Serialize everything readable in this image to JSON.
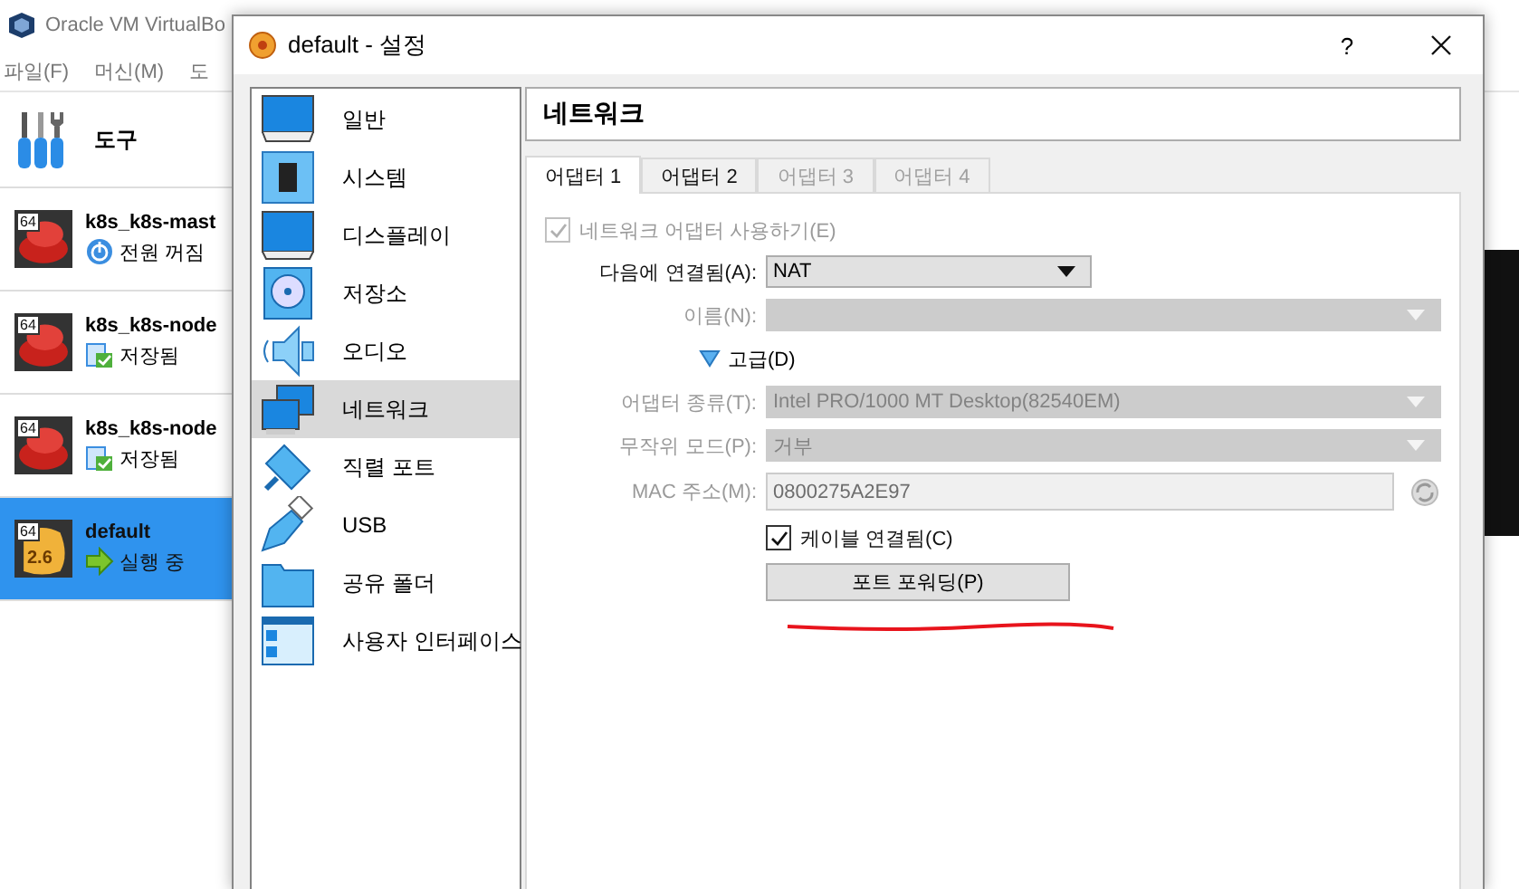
{
  "manager": {
    "title": "Oracle VM VirtualBo",
    "menu": [
      "파일(F)",
      "머신(M)",
      "도"
    ],
    "tools_label": "도구",
    "vms": [
      {
        "name": "k8s_k8s-mast",
        "state": "전원 꺼짐",
        "kind": "off",
        "version": "64",
        "selected": false
      },
      {
        "name": "k8s_k8s-node",
        "state": "저장됨",
        "kind": "saved",
        "version": "64",
        "selected": false
      },
      {
        "name": "k8s_k8s-node",
        "state": "저장됨",
        "kind": "saved",
        "version": "64",
        "selected": false
      },
      {
        "name": "default",
        "state": "실행 중",
        "kind": "running",
        "version": "64",
        "badge": "2.6",
        "selected": true
      }
    ]
  },
  "dialog": {
    "title": "default - 설정",
    "help": "?",
    "sidebar": [
      {
        "label": "일반",
        "kind": "general",
        "selected": false
      },
      {
        "label": "시스템",
        "kind": "system",
        "selected": false
      },
      {
        "label": "디스플레이",
        "kind": "display",
        "selected": false
      },
      {
        "label": "저장소",
        "kind": "storage",
        "selected": false
      },
      {
        "label": "오디오",
        "kind": "audio",
        "selected": false
      },
      {
        "label": "네트워크",
        "kind": "network",
        "selected": true
      },
      {
        "label": "직렬 포트",
        "kind": "serial",
        "selected": false
      },
      {
        "label": "USB",
        "kind": "usb",
        "selected": false
      },
      {
        "label": "공유 폴더",
        "kind": "shared",
        "selected": false
      },
      {
        "label": "사용자 인터페이스",
        "kind": "ui",
        "selected": false
      }
    ],
    "header": "네트워크",
    "tabs": [
      {
        "label": "어댑터 1",
        "selected": true,
        "disabled": false
      },
      {
        "label": "어댑터 2",
        "selected": false,
        "disabled": false
      },
      {
        "label": "어댑터 3",
        "selected": false,
        "disabled": true
      },
      {
        "label": "어댑터 4",
        "selected": false,
        "disabled": true
      }
    ],
    "enable_adapter": {
      "label": "네트워크 어댑터 사용하기(E)",
      "checked": true,
      "disabled": true
    },
    "fields": [
      {
        "kind": "select",
        "label": "다음에 연결됨(A):",
        "value": "NAT",
        "disabled": false
      },
      {
        "kind": "select",
        "label": "이름(N):",
        "disabled": true
      },
      {
        "kind": "expander",
        "label": "고급(D)",
        "expanded": true
      },
      {
        "kind": "select",
        "label": "어댑터 종류(T):",
        "value": "Intel PRO/1000 MT Desktop(82540EM)",
        "disabled": true
      },
      {
        "kind": "select",
        "label": "무작위 모드(P):",
        "value": "거부",
        "disabled": true
      },
      {
        "kind": "text",
        "label": "MAC 주소(M):",
        "value": "0800275A2E97",
        "disabled": true
      }
    ],
    "cable": {
      "label": "케이블 연결됨(C)",
      "checked": true,
      "disabled": false
    },
    "port_forwarding_button": "포트 포워딩(P)"
  }
}
